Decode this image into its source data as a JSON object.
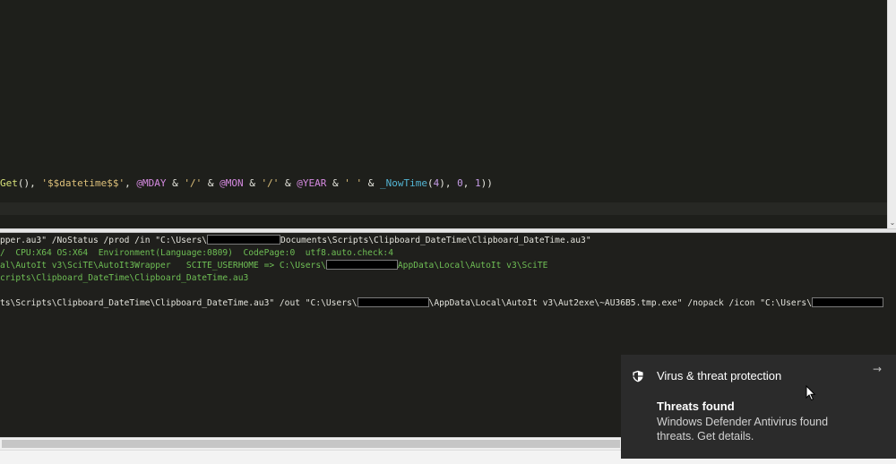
{
  "editor": {
    "code_tokens": [
      {
        "text": "Get",
        "cls": "tk-fn"
      },
      {
        "text": "(), ",
        "cls": "tk-punct"
      },
      {
        "text": "'$$datetime$$'",
        "cls": "tk-str"
      },
      {
        "text": ", ",
        "cls": "tk-punct"
      },
      {
        "text": "@MDAY",
        "cls": "tk-macro"
      },
      {
        "text": " & ",
        "cls": "tk-op"
      },
      {
        "text": "'/'",
        "cls": "tk-str"
      },
      {
        "text": " & ",
        "cls": "tk-op"
      },
      {
        "text": "@MON",
        "cls": "tk-macro"
      },
      {
        "text": " & ",
        "cls": "tk-op"
      },
      {
        "text": "'/'",
        "cls": "tk-str"
      },
      {
        "text": " & ",
        "cls": "tk-op"
      },
      {
        "text": "@YEAR",
        "cls": "tk-macro"
      },
      {
        "text": " & ",
        "cls": "tk-op"
      },
      {
        "text": "' '",
        "cls": "tk-str"
      },
      {
        "text": " & ",
        "cls": "tk-op"
      },
      {
        "text": "_NowTime",
        "cls": "tk-udf"
      },
      {
        "text": "(",
        "cls": "tk-punct"
      },
      {
        "text": "4",
        "cls": "tk-num"
      },
      {
        "text": "), ",
        "cls": "tk-punct"
      },
      {
        "text": "0",
        "cls": "tk-num"
      },
      {
        "text": ", ",
        "cls": "tk-punct"
      },
      {
        "text": "1",
        "cls": "tk-num"
      },
      {
        "text": "))",
        "cls": "tk-punct"
      }
    ],
    "scroll_arrow": "⌄"
  },
  "output": {
    "line1": {
      "a": "pper.au3\" /NoStatus /prod /in \"C:\\Users\\",
      "b": "Documents\\Scripts\\Clipboard_DateTime\\Clipboard_DateTime.au3\""
    },
    "line2": {
      "a": "/  CPU:X64 OS:X64  Environment(Language:0809)  CodePage:0  utf8.auto.check:4"
    },
    "line3": {
      "a": "al\\AutoIt v3\\SciTE\\AutoIt3Wrapper   SCITE_USERHOME => C:\\Users\\",
      "b": "AppData\\Local\\AutoIt v3\\SciTE"
    },
    "line4": {
      "a": "cripts\\Clipboard_DateTime\\Clipboard_DateTime.au3"
    },
    "line5": {
      "a": "ts\\Scripts\\Clipboard_DateTime\\Clipboard_DateTime.au3\" /out \"C:\\Users\\",
      "b": "\\AppData\\Local\\AutoIt v3\\Aut2exe\\~AU36B5.tmp.exe\" /nopack /icon \"C:\\Users\\"
    }
  },
  "toast": {
    "app_name": "Virus & threat protection",
    "arrow": "→",
    "title": "Threats found",
    "body": "Windows Defender Antivirus found threats. Get details."
  }
}
